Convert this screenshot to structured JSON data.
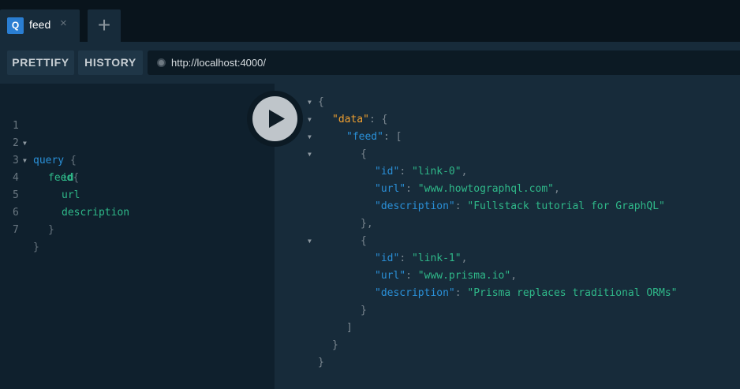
{
  "tabs": {
    "active": {
      "badge": "Q",
      "label": "feed",
      "close": "×"
    },
    "add_symbol": "+"
  },
  "toolbar": {
    "prettify_label": "PRETTIFY",
    "history_label": "HISTORY",
    "endpoint_url": "http://localhost:4000/"
  },
  "query": {
    "line_numbers": [
      "1",
      "2",
      "3",
      "4",
      "5",
      "6",
      "7"
    ],
    "lines": {
      "l1_keyword": "query",
      "l1_brace": "{",
      "l2_field": "feed",
      "l2_brace": "{",
      "l3_field": "id",
      "l4_field": "url",
      "l5_field": "description",
      "l6_brace": "}",
      "l7_brace": "}"
    }
  },
  "result": {
    "open_root": "{",
    "data_key": "\"data\"",
    "feed_key": "\"feed\"",
    "colon": ":",
    "open_brace": "{",
    "open_bracket": "[",
    "close_brace": "}",
    "close_brace_comma": "},",
    "close_bracket": "]",
    "comma": ",",
    "items": [
      {
        "id_key": "\"id\"",
        "id_val": "\"link-0\"",
        "url_key": "\"url\"",
        "url_val": "\"www.howtographql.com\"",
        "desc_key": "\"description\"",
        "desc_val": "\"Fullstack tutorial for GraphQL\""
      },
      {
        "id_key": "\"id\"",
        "id_val": "\"link-1\"",
        "url_key": "\"url\"",
        "url_val": "\"www.prisma.io\"",
        "desc_key": "\"description\"",
        "desc_val": "\"Prisma replaces traditional ORMs\""
      }
    ]
  },
  "colors": {
    "keyword": "#2a90d8",
    "field": "#2fb889",
    "top_key": "#f0a030",
    "badge": "#2a7ed2"
  }
}
